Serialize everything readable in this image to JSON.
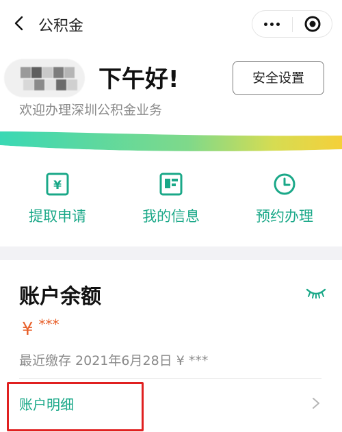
{
  "nav": {
    "title": "公积金",
    "back_icon": "chevron-left-icon",
    "more_icon": "more-dots-icon",
    "close_icon": "target-circle-icon"
  },
  "header": {
    "greeting": "下午好!",
    "welcome": "欢迎办理深圳公积金业务",
    "security_button": "安全设置"
  },
  "quick_actions": [
    {
      "label": "提取申请",
      "icon": "yuan-icon"
    },
    {
      "label": "我的信息",
      "icon": "info-card-icon"
    },
    {
      "label": "预约办理",
      "icon": "clock-icon"
    }
  ],
  "account": {
    "title": "账户余额",
    "amount_currency": "¥",
    "amount_masked": "***",
    "recent_deposit": "最近缴存 2021年6月28日 ¥ ***",
    "detail_link": "账户明细",
    "visibility_icon": "eye-closed-icon"
  },
  "colors": {
    "accent": "#1aa888",
    "amount": "#e8612c",
    "wave_teal": "#35d6b3",
    "wave_yellow": "#f5d03a",
    "highlight": "#e02020"
  }
}
